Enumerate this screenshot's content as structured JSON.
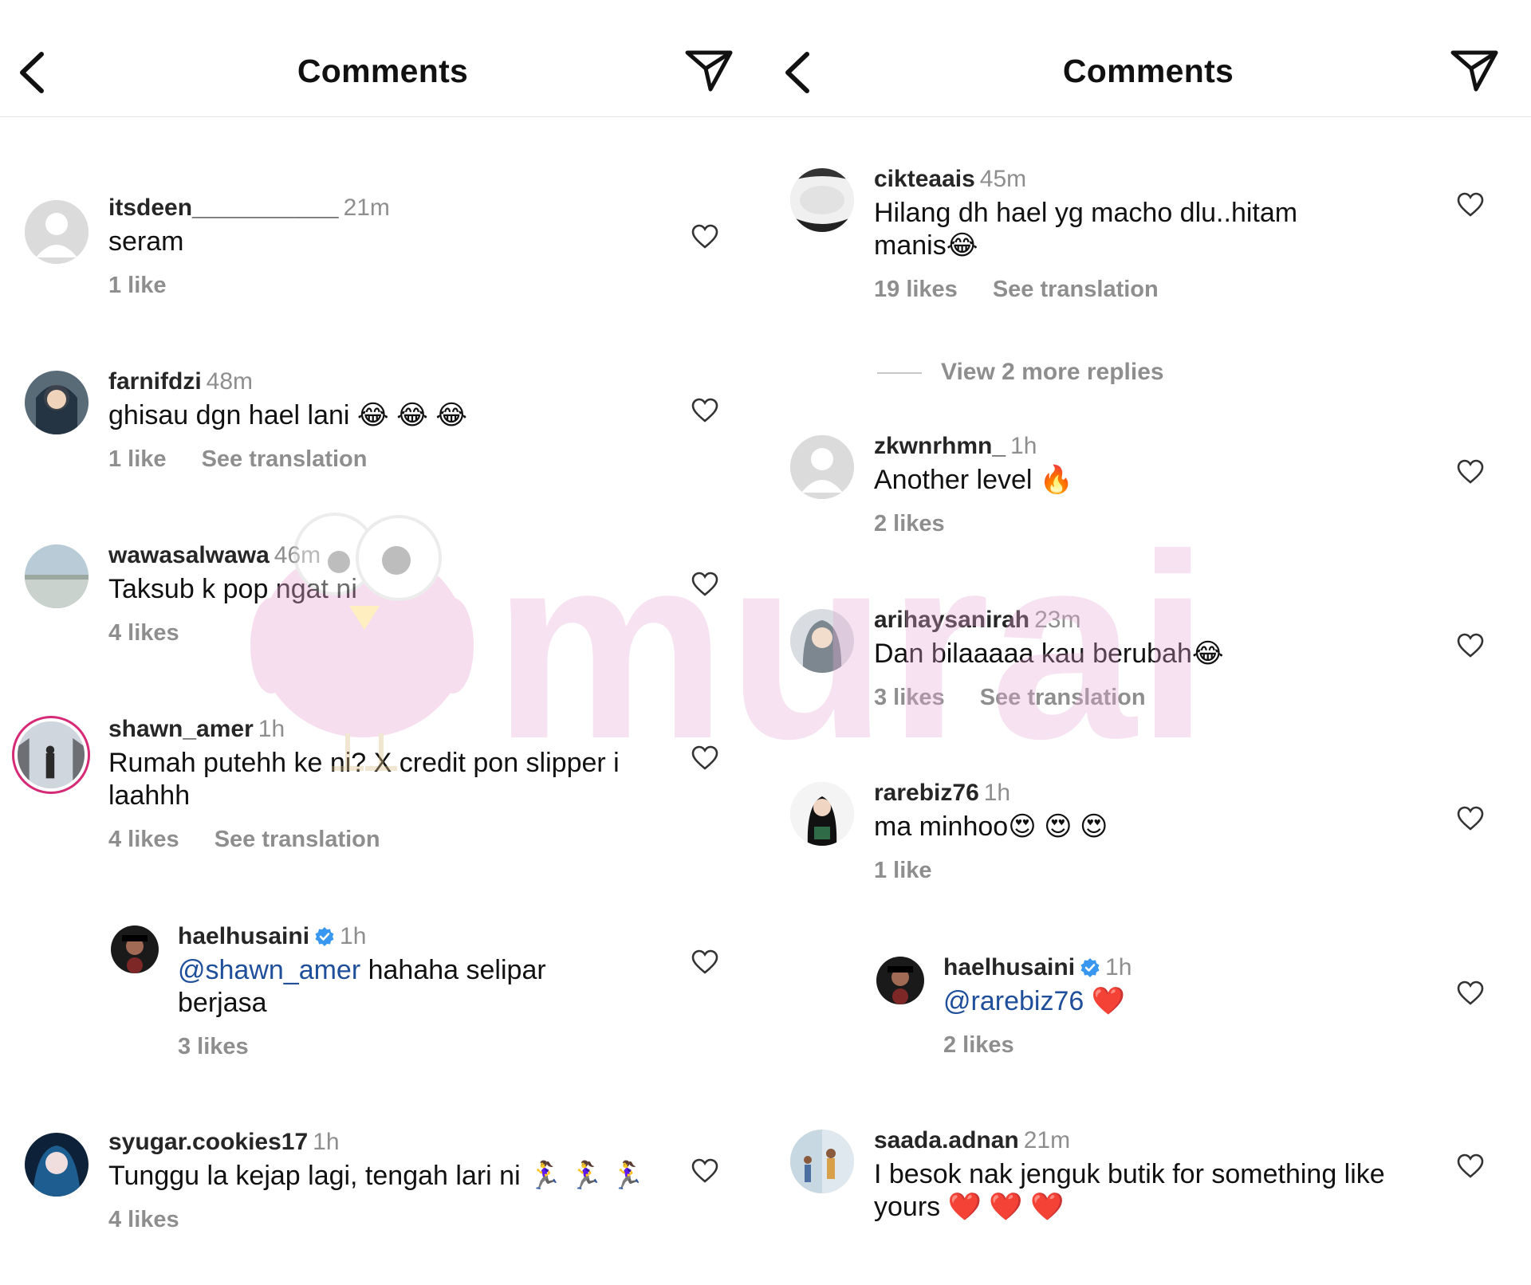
{
  "left_panel": {
    "header": {
      "title": "Comments",
      "back_icon": "chevron-left-icon",
      "send_icon": "paper-plane-icon"
    },
    "comments": [
      {
        "user": "itsdeen___________",
        "time": "21m",
        "text": "seram",
        "likes": "1 like",
        "translation": ""
      },
      {
        "user": "farnifdzi",
        "time": "48m",
        "text": "ghisau dgn hael lani",
        "emoji": "😂 😂 😂",
        "likes": "1 like",
        "translation": "See translation"
      },
      {
        "user": "wawasalwawa",
        "time": "46m",
        "text": "Taksub k pop ngat ni",
        "likes": "4 likes",
        "translation": ""
      },
      {
        "user": "shawn_amer",
        "time": "1h",
        "text": "Rumah putehh ke ni? X credit pon slipper i laahhh",
        "likes": "4 likes",
        "translation": "See translation"
      },
      {
        "user": "haelhusaini",
        "time": "1h",
        "mention": "@shawn_amer",
        "text": " hahaha selipar berjasa",
        "likes": "3 likes",
        "verified": true
      },
      {
        "user": "syugar.cookies17",
        "time": "1h",
        "text": "Tunggu la kejap lagi, tengah lari ni",
        "emoji": "🏃‍♀️ 🏃‍♀️ 🏃‍♀️",
        "likes": "4 likes"
      }
    ]
  },
  "right_panel": {
    "header": {
      "title": "Comments",
      "back_icon": "chevron-left-icon",
      "send_icon": "paper-plane-icon"
    },
    "comments": [
      {
        "user": "cikteaais",
        "time": "45m",
        "text": "Hilang dh hael yg macho dlu..hitam manis",
        "emoji": "😂",
        "likes": "19 likes",
        "translation": "See translation"
      },
      {
        "user": "zkwnrhmn_",
        "time": "1h",
        "text": "Another level",
        "emoji": "🔥",
        "likes": "2 likes"
      },
      {
        "user": "arihaysanirah",
        "time": "23m",
        "text": "Dan bilaaaaa kau berubah",
        "emoji": "😂",
        "likes": "3 likes",
        "translation": "See translation"
      },
      {
        "user": "rarebiz76",
        "time": "1h",
        "text": "ma minhoo",
        "emoji": "😍 😍 😍",
        "likes": "1 like"
      },
      {
        "user": "haelhusaini",
        "time": "1h",
        "mention": "@rarebiz76",
        "emoji": "❤️",
        "likes": "2 likes",
        "verified": true
      },
      {
        "user": "saada.adnan",
        "time": "21m",
        "text": "I besok nak jenguk butik for something like yours",
        "emoji": "❤️ ❤️ ❤️"
      }
    ],
    "view_replies": "View 2 more replies"
  },
  "watermark": {
    "text": "murai"
  },
  "colors": {
    "accent_ring": "#d62976",
    "mention": "#1f4f9a",
    "muted": "#8e8e8e",
    "verified": "#3897f0"
  },
  "icons": {
    "like": "heart-outline-icon",
    "verified": "verified-badge-icon",
    "default_avatar": "default-avatar-icon"
  }
}
